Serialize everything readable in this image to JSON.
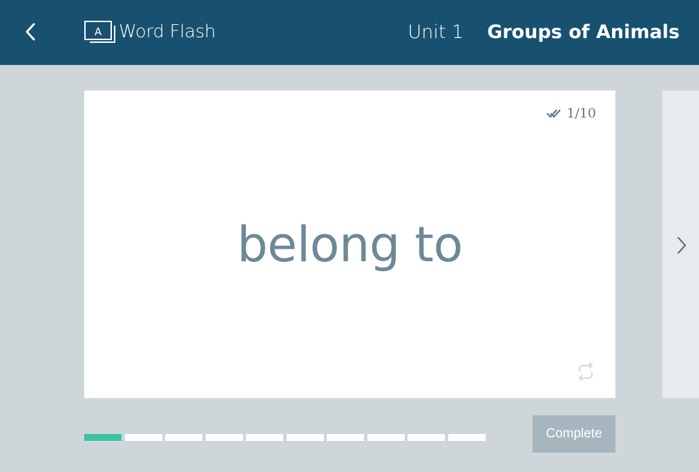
{
  "header": {
    "back_icon": "chevron-left-icon",
    "app_icon": "flashcard-a-icon",
    "app_title": "Word Flash",
    "unit_label": "Unit 1",
    "lesson_title": "Groups of Animals"
  },
  "card": {
    "counter_icon": "double-check-icon",
    "counter_text": "1/10",
    "word": "belong to",
    "flip_icon": "flip-arrows-icon"
  },
  "next": {
    "icon": "chevron-right-icon"
  },
  "progress": {
    "current": 1,
    "total": 10
  },
  "complete_label": "Complete",
  "colors": {
    "header_bg": "#185070",
    "page_bg": "#cfd6da",
    "accent": "#39c2a4",
    "word_color": "#6d8896",
    "button_bg": "#a7b6be"
  }
}
